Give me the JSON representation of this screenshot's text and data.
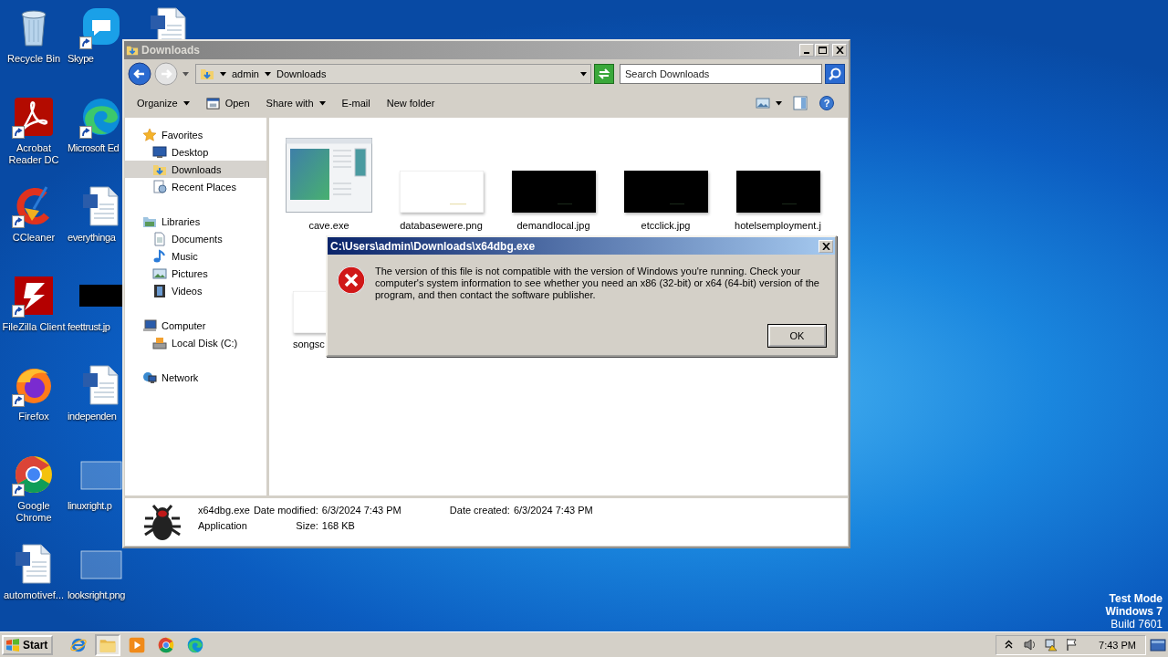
{
  "desktop": {
    "columns": [
      [
        {
          "label": "Recycle Bin",
          "kind": "recycle-bin",
          "shortcut": false
        },
        {
          "label": "Acrobat Reader DC",
          "kind": "acrobat",
          "shortcut": true
        },
        {
          "label": "CCleaner",
          "kind": "ccleaner",
          "shortcut": true
        },
        {
          "label": "FileZilla Client",
          "kind": "filezilla",
          "shortcut": true
        },
        {
          "label": "Firefox",
          "kind": "firefox",
          "shortcut": true
        },
        {
          "label": "Google Chrome",
          "kind": "chrome",
          "shortcut": true
        },
        {
          "label": "automotivef...",
          "kind": "word-doc",
          "shortcut": false
        }
      ],
      [
        {
          "label": "Skype",
          "kind": "skype",
          "shortcut": true
        },
        {
          "label": "Microsoft Ed",
          "kind": "edge",
          "shortcut": true
        },
        {
          "label": "everythinga",
          "kind": "word-doc",
          "shortcut": false
        },
        {
          "label": "feettrust.jp",
          "kind": "image-black",
          "shortcut": false
        },
        {
          "label": "independen",
          "kind": "word-doc",
          "shortcut": false
        },
        {
          "label": "linuxright.p",
          "kind": "image-blank",
          "shortcut": false
        },
        {
          "label": "looksright.png",
          "kind": "image-blank",
          "shortcut": false
        }
      ],
      [
        {
          "kind": "word-doc",
          "shortcut": false
        }
      ]
    ],
    "test_mode_notice": [
      "Test Mode",
      "Windows 7",
      "Build 7601"
    ]
  },
  "explorer": {
    "title": "Downloads",
    "back": {
      "disabled": false
    },
    "forward": {
      "disabled": true
    },
    "breadcrumb": [
      "admin",
      "Downloads"
    ],
    "search": {
      "placeholder": "Search Downloads"
    },
    "toolbar": [
      {
        "label": "Organize",
        "kind": "menu"
      },
      {
        "label": "Open",
        "kind": "open"
      },
      {
        "label": "Share with",
        "kind": "menu"
      },
      {
        "label": "E-mail",
        "kind": "plain"
      },
      {
        "label": "New folder",
        "kind": "plain"
      }
    ],
    "help": "?",
    "nav": [
      {
        "label": "Favorites",
        "kind": "star",
        "selected": false,
        "children": [
          {
            "label": "Desktop",
            "kind": "desktop",
            "selected": false
          },
          {
            "label": "Downloads",
            "kind": "downloads",
            "selected": true
          },
          {
            "label": "Recent Places",
            "kind": "recent",
            "selected": false
          }
        ]
      },
      {
        "label": "Libraries",
        "kind": "library",
        "selected": false,
        "children": [
          {
            "label": "Documents",
            "kind": "document",
            "selected": false
          },
          {
            "label": "Music",
            "kind": "music",
            "selected": false
          },
          {
            "label": "Pictures",
            "kind": "pictures",
            "selected": false
          },
          {
            "label": "Videos",
            "kind": "videos",
            "selected": false
          }
        ]
      },
      {
        "label": "Computer",
        "kind": "computer",
        "selected": false,
        "children": [
          {
            "label": "Local Disk (C:)",
            "kind": "drive",
            "selected": false
          }
        ]
      },
      {
        "label": "Network",
        "kind": "network",
        "selected": false
      }
    ],
    "files": {
      "rows": [
        [
          {
            "name": "cave.exe",
            "kind": "app-window"
          },
          {
            "name": "databasewere.png",
            "kind": "image-white"
          },
          {
            "name": "demandlocal.jpg",
            "kind": "image-black"
          },
          {
            "name": "etcclick.jpg",
            "kind": "image-black"
          },
          {
            "name": "hotelsemployment.j",
            "kind": "image-black"
          }
        ],
        [
          {
            "name": "songsc",
            "kind": "image-white"
          }
        ]
      ]
    },
    "details": {
      "name": "x64dbg.exe",
      "type": "Application",
      "fields": [
        {
          "label": "Date modified:",
          "value": "6/3/2024 7:43 PM"
        },
        {
          "label": "Size:",
          "value": "168 KB"
        },
        {
          "label": "Date created:",
          "value": "6/3/2024 7:43 PM"
        }
      ]
    }
  },
  "dialog": {
    "title": "C:\\Users\\admin\\Downloads\\x64dbg.exe",
    "message": "The version of this file is not compatible with the version of Windows you're running. Check your computer's system information to see whether you need an x86 (32-bit) or x64 (64-bit) version of the program, and then contact the software publisher.",
    "buttons": [
      "OK"
    ]
  },
  "taskbar": {
    "start": "Start",
    "apps": [
      {
        "kind": "ie",
        "selected": false
      },
      {
        "kind": "explorer",
        "selected": true
      },
      {
        "kind": "media",
        "selected": false
      },
      {
        "kind": "chrome",
        "selected": false
      },
      {
        "kind": "edge",
        "selected": false
      }
    ],
    "clock": "7:43 PM"
  }
}
